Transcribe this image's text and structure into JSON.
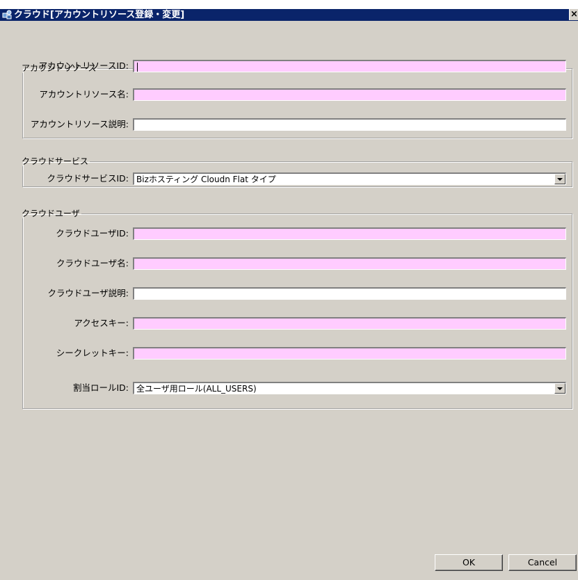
{
  "window": {
    "title": "クラウド[アカウントリソース登録・変更]",
    "close_label": "×"
  },
  "account": {
    "legend": "アカウントリソース",
    "id_label": "アカウントリソースID:",
    "name_label": "アカウントリソース名:",
    "desc_label": "アカウントリソース説明:",
    "id_value": "",
    "name_value": "",
    "desc_value": ""
  },
  "service": {
    "legend": "クラウドサービス",
    "id_label": "クラウドサービスID:",
    "id_value": "Bizホスティング Cloudn Flat タイプ"
  },
  "user": {
    "legend": "クラウドユーザ",
    "id_label": "クラウドユーザID:",
    "name_label": "クラウドユーザ名:",
    "desc_label": "クラウドユーザ説明:",
    "access_label": "アクセスキー:",
    "secret_label": "シークレットキー:",
    "role_label": "割当ロールID:",
    "id_value": "",
    "name_value": "",
    "desc_value": "",
    "access_value": "",
    "secret_value": "",
    "role_value": "全ユーザ用ロール(ALL_USERS)"
  },
  "buttons": {
    "ok": "OK",
    "cancel": "Cancel"
  },
  "colors": {
    "title_bar": "#0a246a",
    "required_field": "#ffccff",
    "background": "#d4d0c8"
  }
}
